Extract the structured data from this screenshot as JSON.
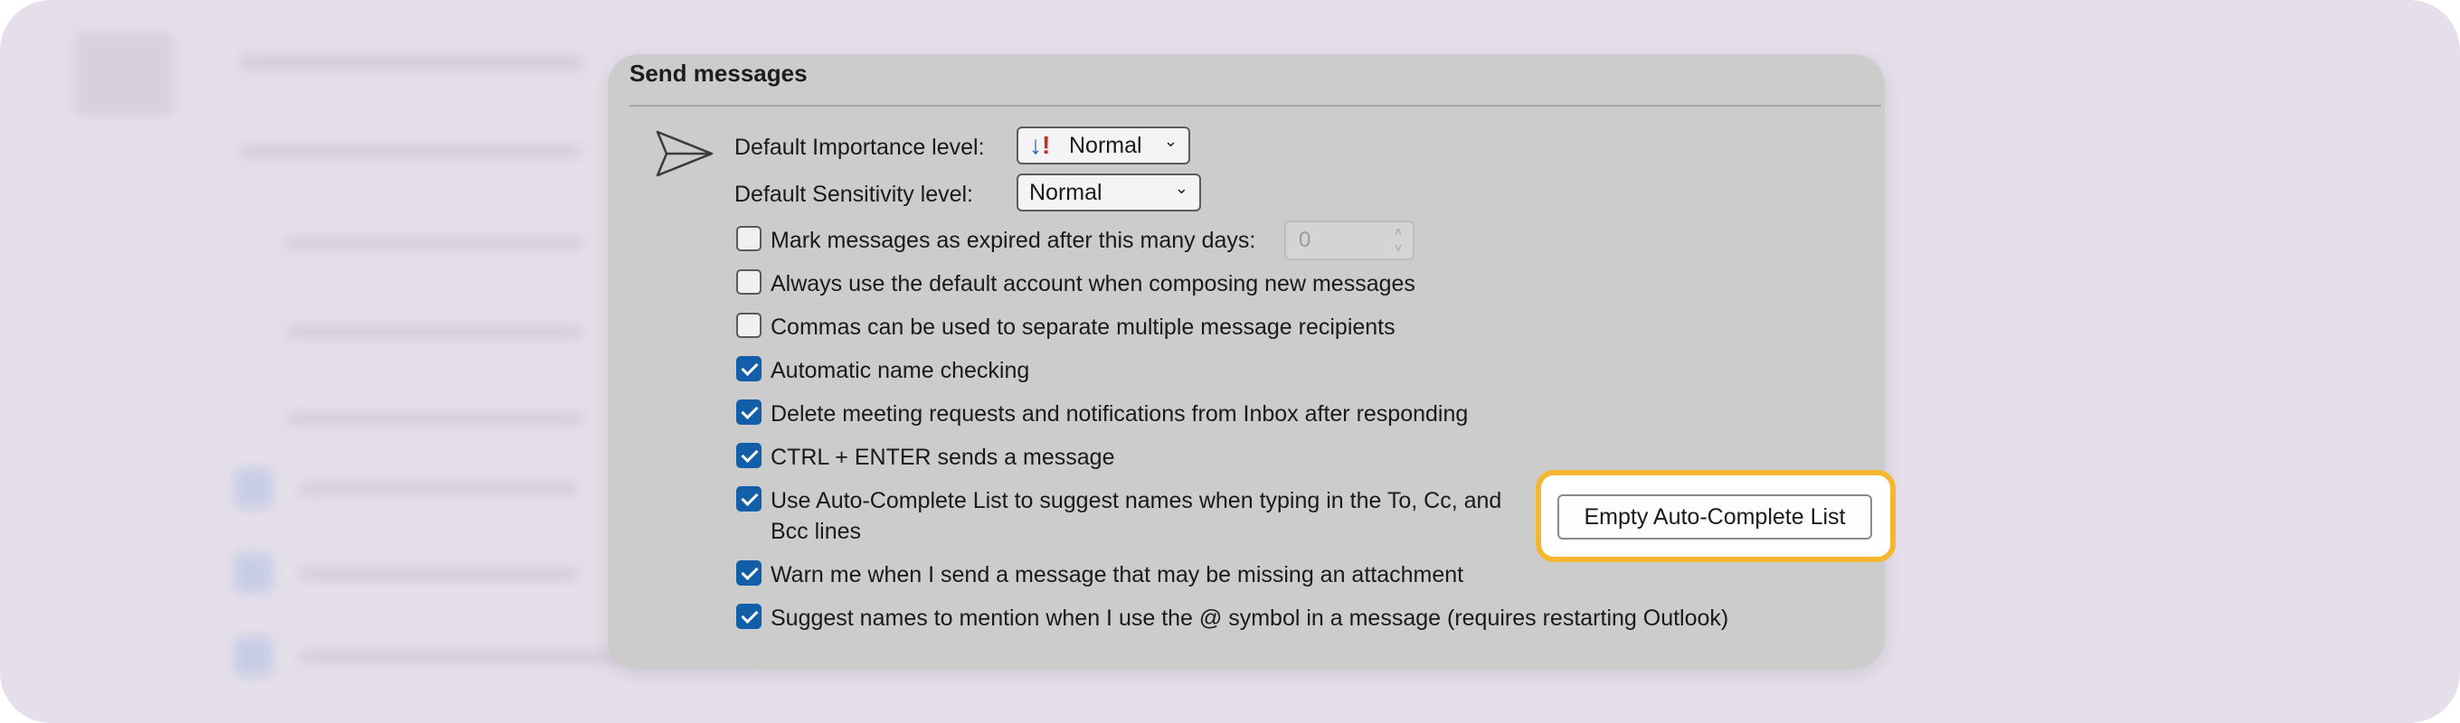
{
  "section": {
    "title": "Send messages"
  },
  "importance": {
    "label": "Default Importance level:",
    "value": "Normal"
  },
  "sensitivity": {
    "label": "Default Sensitivity level:",
    "value": "Normal"
  },
  "expire": {
    "label": "Mark messages as expired after this many days:",
    "value": "0"
  },
  "options": [
    {
      "label": "Always use the default account when composing new messages",
      "checked": false
    },
    {
      "label": "Commas can be used to separate multiple message recipients",
      "checked": false
    },
    {
      "label": "Automatic name checking",
      "checked": true
    },
    {
      "label": "Delete meeting requests and notifications from Inbox after responding",
      "checked": true
    },
    {
      "label": "CTRL + ENTER sends a message",
      "checked": true
    },
    {
      "label_line1": "Use Auto-Complete List to suggest names when typing in the To, Cc, and",
      "label_line2": "Bcc lines",
      "checked": true
    },
    {
      "label": "Warn me when I send a message that may be missing an attachment",
      "checked": true
    },
    {
      "label": "Suggest names to mention when I use the @ symbol in a message (requires restarting Outlook)",
      "checked": true
    }
  ],
  "buttons": {
    "empty_autocomplete": "Empty Auto-Complete List"
  },
  "icons": {
    "send": "send-icon",
    "importance": "importance-icon",
    "dropdown": "chevron-down-icon"
  },
  "colors": {
    "highlight": "#f5b731",
    "checkbox_checked": "#125ea8",
    "panel": "#cccccc",
    "backdrop": "#e4dfea"
  }
}
